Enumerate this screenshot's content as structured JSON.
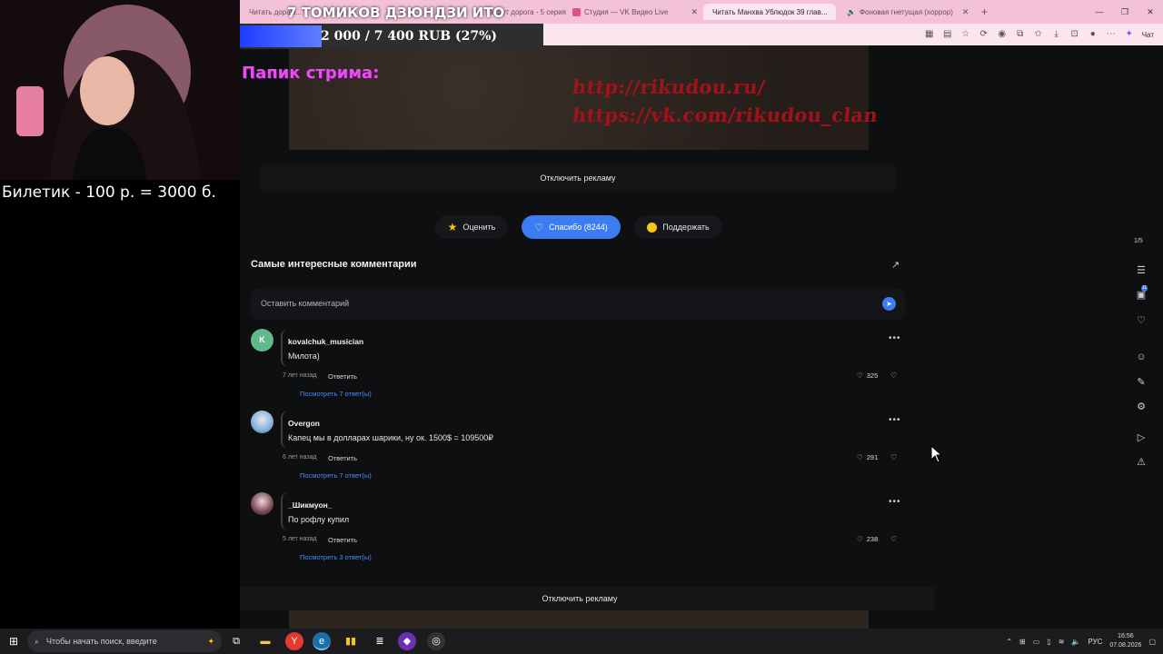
{
  "browser": {
    "tabs": [
      {
        "label": "Читать дорам...",
        "active": false
      },
      {
        "label": "Ищут дорога - 5 серия",
        "active": false
      },
      {
        "label": "Студия — VK Видео Live",
        "active": false
      },
      {
        "label": "Читать Манхва Ублюдок 39 глав...",
        "active": true
      },
      {
        "label": "Фоновая гнетущая (хоррор)",
        "active": false
      }
    ],
    "new_tab": "+",
    "chat_label": "Чат"
  },
  "stream": {
    "title": "7 ТОМИКОВ ДЗЮНДЗИ ИТО",
    "donation_text": "2 000 / 7 400 RUB (27%)",
    "donation_progress": 0.27,
    "papik_label": "Папик стрима:",
    "ticket_text": "Билетик - 100 р. = 3000 б."
  },
  "ad": {
    "line1": "http://rikudou.ru/",
    "line2": "https://vk.com/rikudou_clan",
    "disable_label": "Отключить рекламу"
  },
  "actions": {
    "rate_label": "Оценить",
    "thanks_label": "Спасибо (8244)",
    "support_label": "Поддержать"
  },
  "comments": {
    "title": "Самые интересные комментарии",
    "input_placeholder": "Оставить комментарий",
    "items": [
      {
        "avatar_letter": "K",
        "author": "kovalchuk_musician",
        "text": "Милота)",
        "time": "7 лет назад",
        "reply_label": "Ответить",
        "likes": "325",
        "replies_label": "Посмотреть 7 ответ(ы)"
      },
      {
        "avatar_letter": "",
        "author": "Overgon",
        "text": "Капец мы в долларах шарики, ну ок. 1500$ = 109500₽",
        "time": "6 лет назад",
        "reply_label": "Ответить",
        "likes": "291",
        "replies_label": "Посмотреть 7 ответ(ы)"
      },
      {
        "avatar_letter": "",
        "author": "_Шикмуон_",
        "text": "По рофлу купил",
        "time": "5 лет назад",
        "reply_label": "Ответить",
        "likes": "238",
        "replies_label": "Посмотреть 3 ответ(ы)"
      }
    ]
  },
  "sidebar": {
    "page_counter": "1/5",
    "badge": "11"
  },
  "taskbar": {
    "search_placeholder": "Чтобы начать поиск, введите",
    "lang": "РУС",
    "time": "16:56",
    "date": "07.08.2026"
  },
  "colors": {
    "accent": "#3b7cf0",
    "link": "#4d8cf5",
    "tabbar": "#f3c2d8",
    "papik": "#e94ef0"
  }
}
